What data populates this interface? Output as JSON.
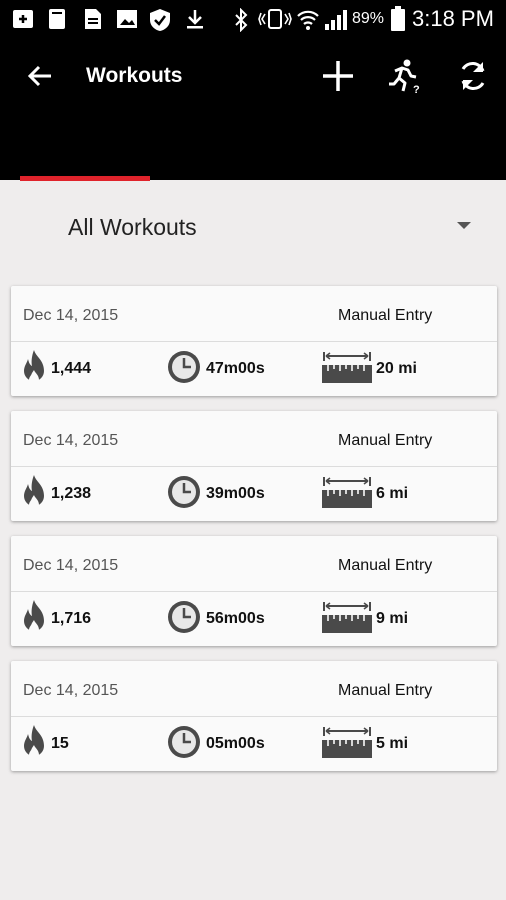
{
  "status_bar": {
    "battery": "89%",
    "time": "3:18 PM"
  },
  "app_bar": {
    "title": "Workouts",
    "actions": [
      "add-icon",
      "running-help-icon",
      "refresh-icon"
    ]
  },
  "filter": {
    "label": "All Workouts"
  },
  "colors": {
    "header": "#000000",
    "accent": "#e0232b",
    "background": "#efeded",
    "icon_gray": "#555555"
  },
  "workouts": [
    {
      "date": "Dec 14, 2015",
      "source": "Manual Entry",
      "calories": "1,444",
      "duration": "47m00s",
      "distance": "20 mi"
    },
    {
      "date": "Dec 14, 2015",
      "source": "Manual Entry",
      "calories": "1,238",
      "duration": "39m00s",
      "distance": "6 mi"
    },
    {
      "date": "Dec 14, 2015",
      "source": "Manual Entry",
      "calories": "1,716",
      "duration": "56m00s",
      "distance": "9 mi"
    },
    {
      "date": "Dec 14, 2015",
      "source": "Manual Entry",
      "calories": "15",
      "duration": "05m00s",
      "distance": "5 mi"
    }
  ]
}
